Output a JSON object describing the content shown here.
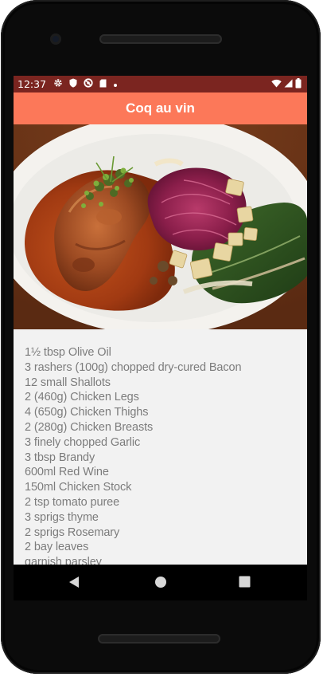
{
  "status_bar": {
    "time": "12:37",
    "left_icons": [
      "gear-icon",
      "shield-icon",
      "block-icon",
      "sd-card-icon",
      "dot-icon"
    ],
    "right_icons": [
      "wifi-icon",
      "signal-icon",
      "battery-icon"
    ]
  },
  "app_bar": {
    "title": "Coq au vin"
  },
  "hero_image": {
    "subject": "coq-au-vin-dish-photo"
  },
  "ingredients": [
    "1½ tbsp Olive Oil",
    "3 rashers (100g) chopped dry-cured Bacon",
    "12 small Shallots",
    "2 (460g) Chicken Legs",
    "4 (650g) Chicken Thighs",
    "2 (280g) Chicken Breasts",
    "3 finely chopped Garlic",
    "3 tbsp Brandy",
    "600ml Red Wine",
    "150ml Chicken Stock",
    "2 tsp tomato puree",
    "3 sprigs thyme",
    "2 sprigs Rosemary",
    "2 bay leaves",
    "garnish parsley"
  ],
  "nav_bar": {
    "buttons": [
      "back-icon",
      "home-icon",
      "recents-icon"
    ]
  },
  "colors": {
    "status_bar": "#7b2520",
    "app_bar": "#fc7859",
    "content_bg": "#f2f2f2",
    "ingredient_text": "#7c7c7c"
  }
}
